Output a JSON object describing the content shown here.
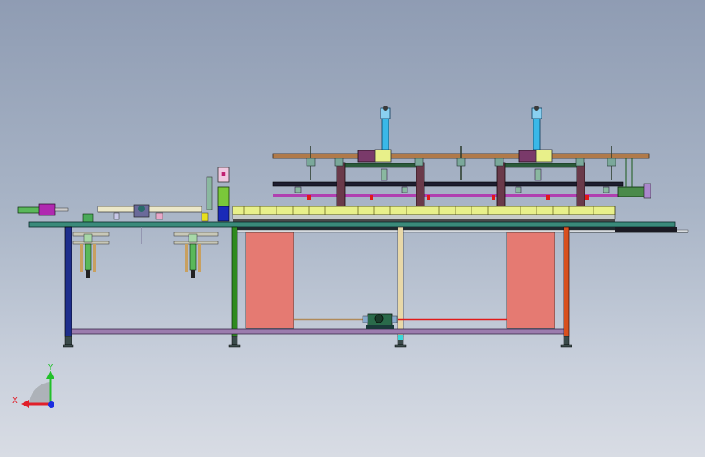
{
  "viewport": {
    "background_top": "#8f9cb3",
    "background_bottom": "#d8dce4"
  },
  "triad": {
    "x_label": "X",
    "y_label": "Y",
    "x_color": "#e0202a",
    "y_color": "#22c02a",
    "z_color": "#1a2de0"
  },
  "colors": {
    "frame_top": "#3a8a7a",
    "leg_left": "#1e2e8c",
    "leg_green": "#2e8a1e",
    "leg_beige": "#e8d8a8",
    "leg_orange": "#d8501e",
    "bottom_rail": "#9c7cae",
    "guard_panel": "#e57a72",
    "rail_wood": "#b07a4a",
    "cylinder_blue": "#3ab8e8",
    "block_purple": "#7a3a6a",
    "conveyor_yellow": "#e8f08a",
    "magenta_rod": "#b040b0",
    "red_fitting": "#e01a1a",
    "motor_green": "#2a6a4a",
    "drive_belt_red": "#e01a1a"
  }
}
